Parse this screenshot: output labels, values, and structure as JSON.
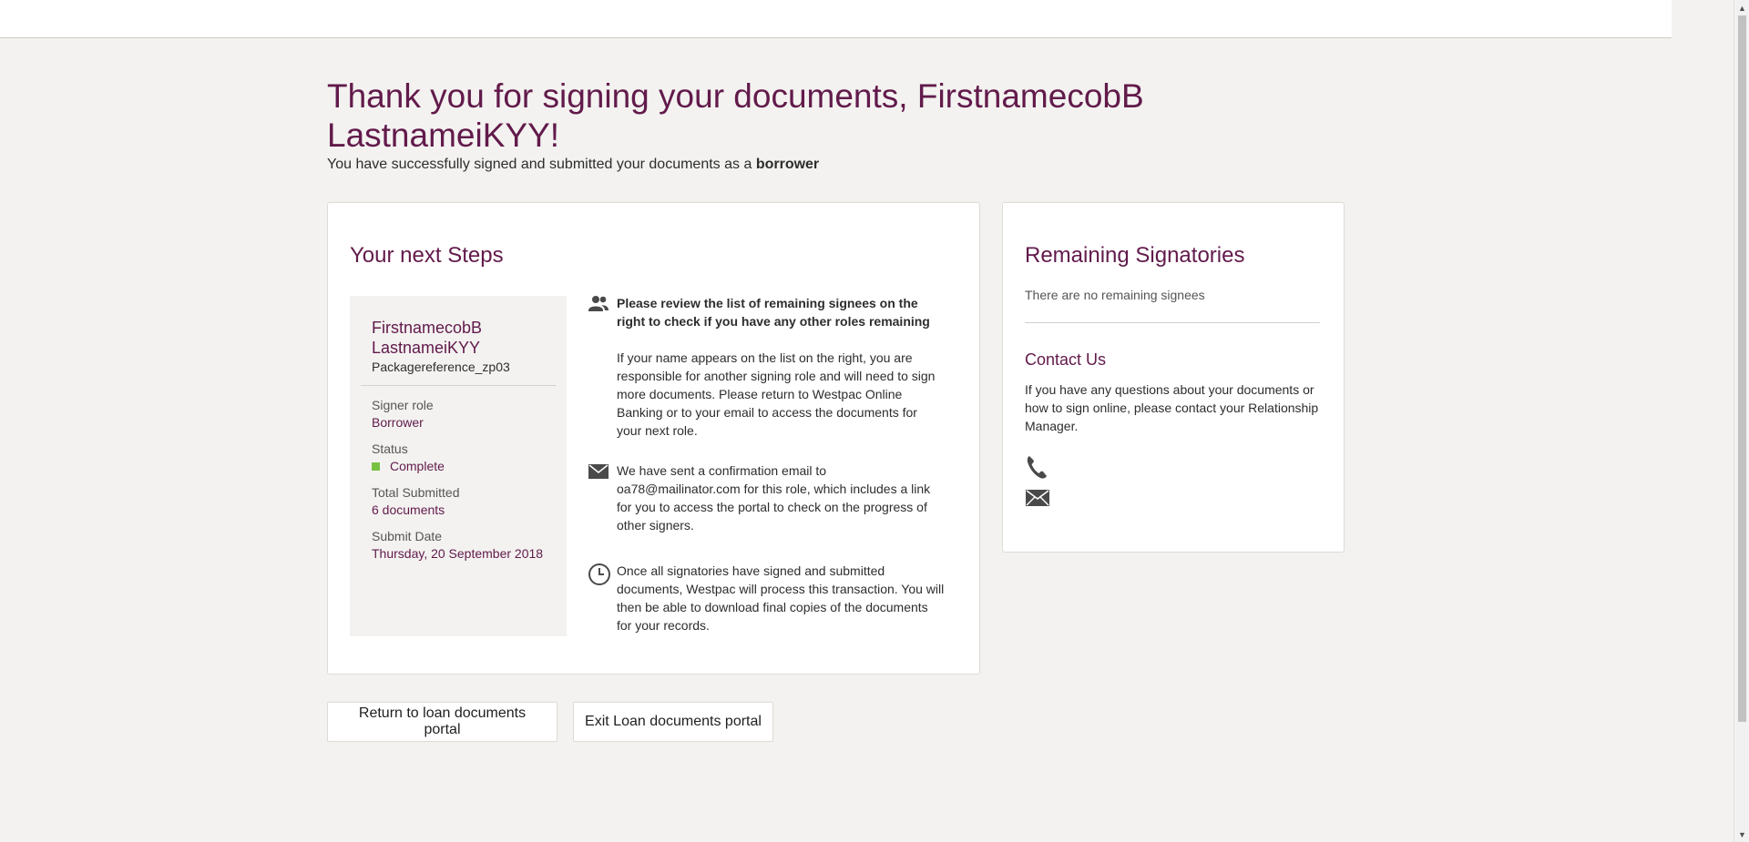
{
  "header": {
    "title_line1": "Thank you for signing your documents, FirstnamecobB",
    "title_line2": "LastnameiKYY!",
    "subtitle_prefix": "You have successfully signed and submitted your documents as a",
    "subtitle_role": "borrower"
  },
  "next_steps": {
    "heading": "Your next Steps",
    "signer": {
      "name_line1": "FirstnamecobB",
      "name_line2": "LastnameiKYY",
      "reference": "Packagereference_zp03",
      "signer_role_label": "Signer role",
      "signer_role_value": "Borrower",
      "status_label": "Status",
      "status_value": "Complete",
      "total_submitted_label": "Total Submitted",
      "total_submitted_value": "6 documents",
      "submit_date_label": "Submit Date",
      "submit_date_value": "Thursday, 20 September 2018"
    },
    "steps": [
      {
        "icon": "people-icon",
        "bold": "Please review the list of remaining signees on the right to check if you have any other roles remaining",
        "text": "If your name appears on the list on the right, you are responsible for another signing role and will need to sign more documents. Please return to Westpac Online Banking or to your email to access the documents for your next role."
      },
      {
        "icon": "envelope-icon",
        "text": "We have sent a confirmation email to oa78@mailinator.com for this role, which includes a link for you to access the portal to check on the progress of other signers."
      },
      {
        "icon": "clock-icon",
        "text": "Once all signatories have signed and submitted documents, Westpac will process this transaction. You will then be able to download final copies of the documents for your records."
      }
    ]
  },
  "remaining": {
    "heading": "Remaining Signatories",
    "empty_text": "There are no remaining signees",
    "contact_heading": "Contact Us",
    "contact_text": "If you have any questions about your documents or how to sign online, please contact your Relationship Manager."
  },
  "buttons": {
    "return_label": "Return to loan documents portal",
    "exit_label": "Exit Loan documents portal"
  },
  "colors": {
    "brand": "#621a4b",
    "status_complete": "#7ac143",
    "background": "#f3f2f0"
  }
}
